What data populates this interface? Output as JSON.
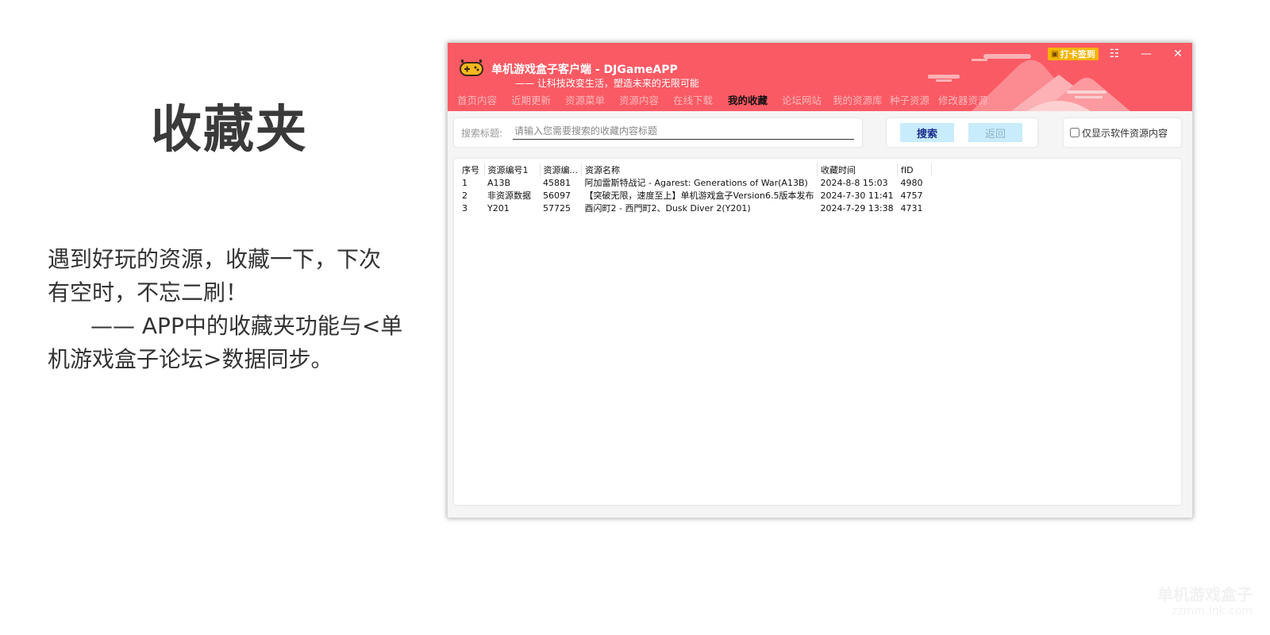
{
  "promo": {
    "title": "收藏夹",
    "line1": "遇到好玩的资源，收藏一下，下次",
    "line2": "有空时，不忘二刷！",
    "line3": "—— APP中的收藏夹功能与<单",
    "line4": "机游戏盒子论坛>数据同步。"
  },
  "app": {
    "title": "单机游戏盒子客户端 - DJGameAPP",
    "subtitle": "—— 让科技改变生活，塑造未来的无限可能",
    "checkin_label": "打卡签到",
    "checkin_icon": "ticket-icon",
    "controls": {
      "menu": "☷",
      "minimize": "—",
      "close": "✕"
    },
    "colors": {
      "titlebar": "#fa5a64",
      "nav_inactive": "#fbb8bc",
      "button_bg": "#c8ecfc",
      "checkin": "#f4b400"
    }
  },
  "nav": [
    {
      "label": "首页内容",
      "active": false
    },
    {
      "label": "近期更新",
      "active": false
    },
    {
      "label": "资源菜单",
      "active": false
    },
    {
      "label": "资源内容",
      "active": false
    },
    {
      "label": "在线下载",
      "active": false
    },
    {
      "label": "我的收藏",
      "active": true
    },
    {
      "label": "论坛网站",
      "active": false
    },
    {
      "label": "我的资源库",
      "active": false
    },
    {
      "label": "种子资源",
      "active": false
    },
    {
      "label": "修改器资源",
      "active": false
    }
  ],
  "search": {
    "label": "搜索标题:",
    "placeholder": "请输入您需要搜索的收藏内容标题",
    "value": "",
    "search_button": "搜索",
    "back_button": "返回",
    "filter_label": "仅显示软件资源内容",
    "filter_checked": false
  },
  "table": {
    "columns": [
      "序号",
      "资源编号1",
      "资源编...",
      "资源名称",
      "收藏时间",
      "fID"
    ],
    "rows": [
      [
        "1",
        "A13B",
        "45881",
        "阿加雷斯特战记 - Agarest: Generations of War(A13B)",
        "2024-8-8 15:03",
        "4980"
      ],
      [
        "2",
        "非资源数据",
        "56097",
        "【突破无限，速度至上】单机游戏盒子Version6.5版本发布",
        "2024-7-30 11:41",
        "4757"
      ],
      [
        "3",
        "Y201",
        "57725",
        "酉闪町2 - 西門町2、Dusk Diver 2(Y201)",
        "2024-7-29 13:38",
        "4731"
      ]
    ]
  },
  "watermark": {
    "line1": "单机游戏盒子",
    "line2": "zzmm.Ink.com"
  }
}
